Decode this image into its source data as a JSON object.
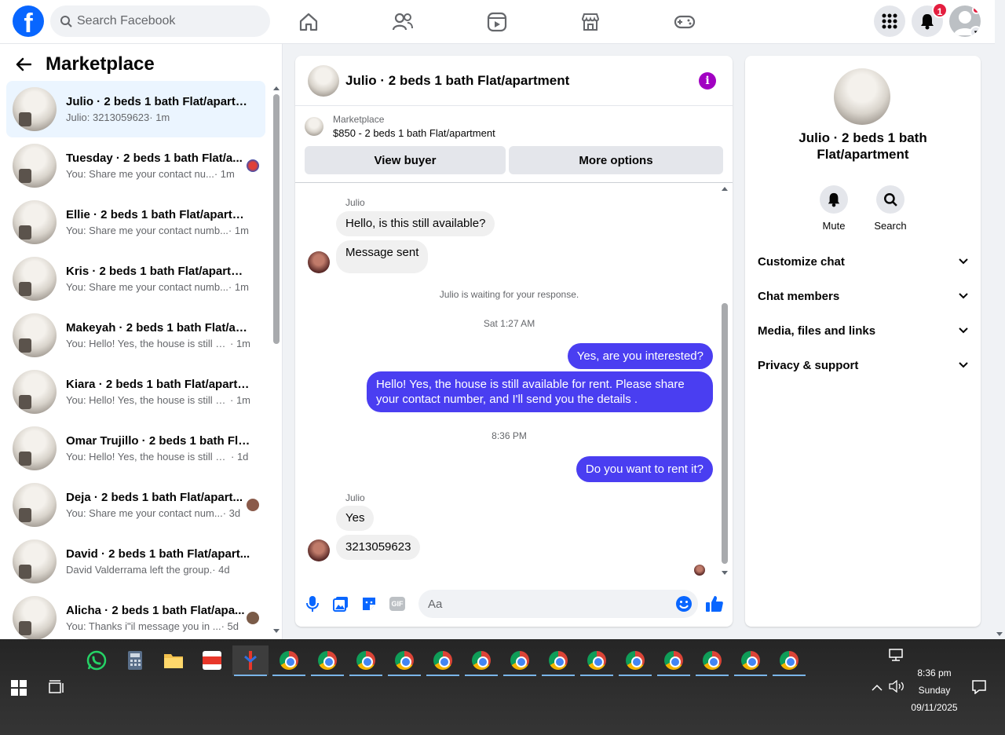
{
  "topbar": {
    "logo": "f",
    "search_placeholder": "Search Facebook",
    "notification_count": "1"
  },
  "sidebar": {
    "title": "Marketplace",
    "conversations": [
      {
        "name": "Julio · 2 beds 1 bath Flat/apartm...",
        "preview": "Julio: 3213059623",
        "time": "· 1m"
      },
      {
        "name": "Tuesday · 2 beds 1 bath Flat/a...",
        "preview": "You: Share me your contact nu...",
        "time": "· 1m"
      },
      {
        "name": "Ellie · 2 beds 1 bath Flat/apartm...",
        "preview": "You: Share me your contact numb...",
        "time": "· 1m"
      },
      {
        "name": "Kris · 2 beds 1 bath Flat/apartme...",
        "preview": "You: Share me your contact numb...",
        "time": "· 1m"
      },
      {
        "name": "Makeyah · 2 beds 1 bath Flat/ap...",
        "preview": "You: Hello! Yes, the house is still av...",
        "time": "· 1m"
      },
      {
        "name": "Kiara · 2 beds 1 bath Flat/apartm...",
        "preview": "You: Hello! Yes, the house is still av...",
        "time": "· 1m"
      },
      {
        "name": "Omar Trujillo · 2 beds 1 bath Flat...",
        "preview": "You: Hello! Yes, the house is still av...",
        "time": "· 1d"
      },
      {
        "name": "Deja · 2 beds 1 bath Flat/apart...",
        "preview": "You: Share me your contact num...",
        "time": "· 3d"
      },
      {
        "name": "David · 2 beds 1 bath Flat/apart...",
        "preview": "David Valderrama left the group.",
        "time": "· 4d"
      },
      {
        "name": "Alicha · 2 beds 1 bath Flat/apa...",
        "preview": "You: Thanks i\"il message you in ...",
        "time": "· 5d"
      }
    ]
  },
  "chat": {
    "title": "Julio · 2 beds 1 bath Flat/apartment",
    "listing_label": "Marketplace",
    "listing_price": "$850 - 2 beds 1 bath Flat/apartment",
    "view_buyer": "View buyer",
    "more_options": "More options",
    "sender_name": "Julio",
    "msg1": "Hello, is this still available?",
    "msg2": "Message sent",
    "system_notice": "Julio is waiting for your response.",
    "ts1": "Sat 1:27 AM",
    "out1": "Yes, are you interested?",
    "out2": "Hello! Yes, the house is still available for rent. Please share your contact number, and I'll send you the details .",
    "ts2": "8:36 PM",
    "out3": "Do you want to rent it?",
    "msg3": "Yes",
    "msg4": "3213059623",
    "input_placeholder": "Aa",
    "gif_label": "GIF"
  },
  "rpanel": {
    "title": "Julio · 2 beds 1 bath Flat/apartment",
    "mute": "Mute",
    "search": "Search",
    "sections": [
      "Customize chat",
      "Chat members",
      "Media, files and links",
      "Privacy & support"
    ]
  },
  "taskbar": {
    "time": "8:36 pm",
    "day": "Sunday",
    "date": "09/11/2025"
  },
  "colors": {
    "brand": "#0866ff",
    "outgoing_bubble": "#4a3ef1",
    "accent_info": "#a100c2",
    "badge": "#e41e3f"
  },
  "icons": [
    "home-icon",
    "friends-icon",
    "video-icon",
    "marketplace-icon",
    "gaming-icon",
    "menu-grid-icon",
    "bell-icon",
    "info-icon",
    "mic-icon",
    "image-icon",
    "sticker-icon",
    "gif-icon",
    "emoji-icon",
    "like-icon"
  ]
}
